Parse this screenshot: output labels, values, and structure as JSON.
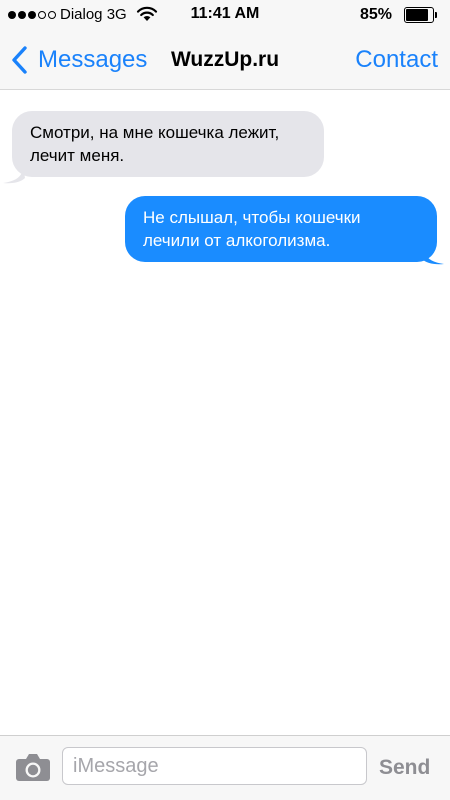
{
  "status_bar": {
    "carrier": "Dialog 3G",
    "signal": {
      "filled": 3,
      "total": 5
    },
    "time": "11:41 AM",
    "battery_percent": "85%",
    "battery_level": 0.85,
    "icons": [
      "signal-dots-icon",
      "wifi-icon",
      "battery-icon"
    ]
  },
  "nav": {
    "back_label": "Messages",
    "title": "WuzzUp.ru",
    "contact_label": "Contact",
    "icons": [
      "chevron-left-icon"
    ]
  },
  "messages": [
    {
      "direction": "incoming",
      "text": "Смотри, на мне кошечка лежит, лечит меня."
    },
    {
      "direction": "outgoing",
      "text": "Не слышал, чтобы кошечки лечили от алкоголизма."
    }
  ],
  "input_bar": {
    "placeholder": "iMessage",
    "value": "",
    "send_label": "Send",
    "icons": [
      "camera-icon"
    ]
  },
  "colors": {
    "accent": "#1a82fb",
    "outgoing_bubble": "#1a8cff",
    "incoming_bubble": "#e5e5ea",
    "bar_background": "#f7f7f7",
    "send_disabled": "#8e8e93"
  }
}
